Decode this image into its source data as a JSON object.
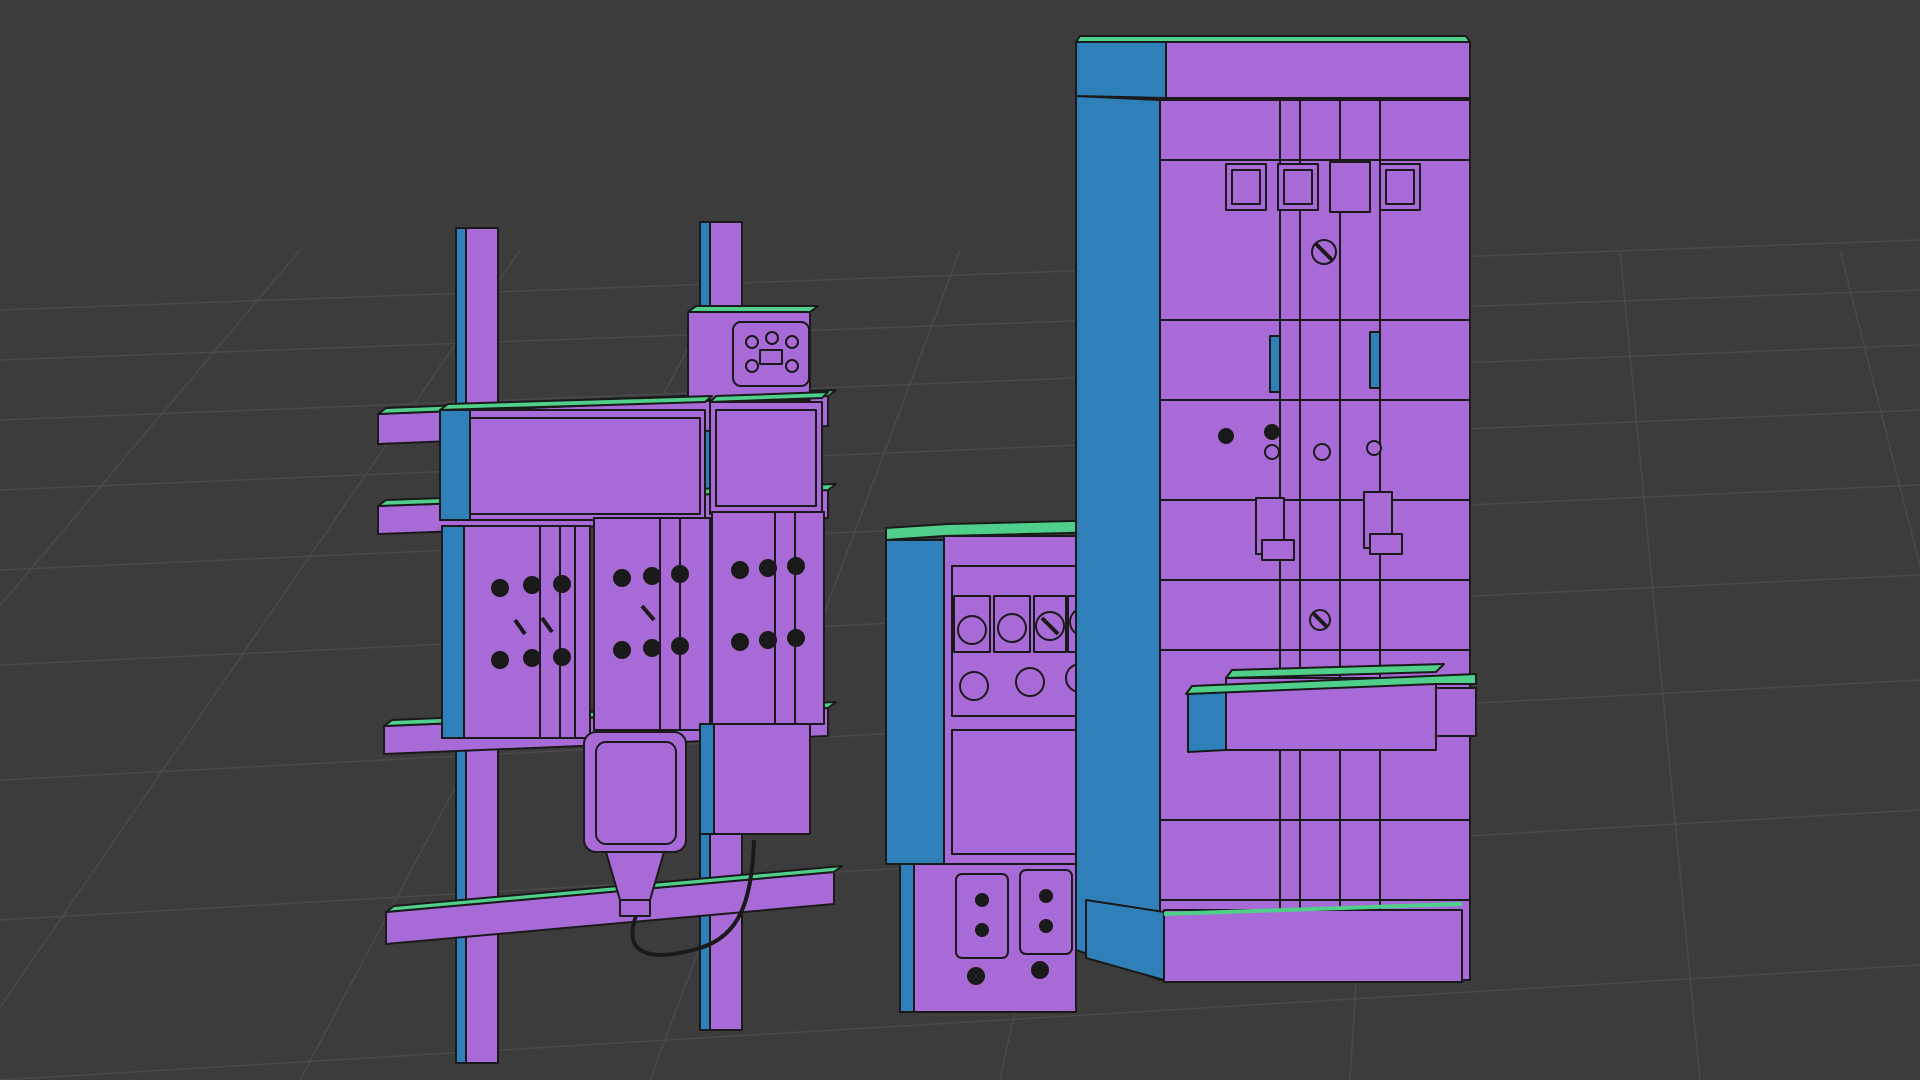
{
  "viewport": {
    "background": "#3c3c3c",
    "grid_color": "#4a4a4a",
    "face_color_front": "#a86ad6",
    "face_color_side": "#2f7fb8",
    "face_color_top": "#4fcf8a",
    "edge_color": "#1a1a1a"
  },
  "objects": [
    {
      "name": "wall-rack-panel"
    },
    {
      "name": "control-box"
    },
    {
      "name": "electrical-cabinet"
    }
  ]
}
